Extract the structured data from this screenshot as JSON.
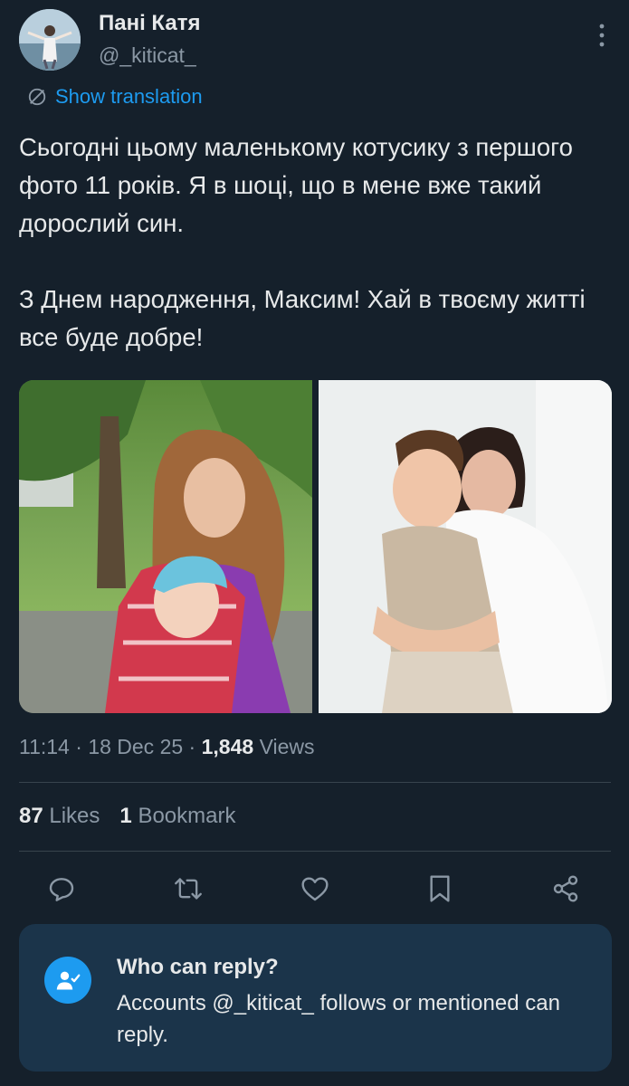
{
  "author": {
    "display_name": "Пані Катя",
    "handle": "@_kiticat_",
    "avatar_icon": "profile-photo"
  },
  "translate_link": "Show translation",
  "tweet": {
    "paragraphs": [
      "Сьогодні цьому маленькому котусику з першого фото 11 років. Я в шоці, що в мене вже такий дорослий син.",
      "З Днем народження, Максим! Хай в твоєму житті все буде добре!"
    ]
  },
  "media": {
    "photo_1": "photo-young-mother-with-baby-in-carrier",
    "photo_2": "photo-mother-hugging-son"
  },
  "meta": {
    "time": "11:14",
    "date": "18 Dec 25",
    "sep": " · ",
    "views_count": "1,848",
    "views_label": "Views"
  },
  "stats": {
    "likes_count": "87",
    "likes_label": "Likes",
    "bookmarks_count": "1",
    "bookmarks_label": "Bookmark"
  },
  "actions": [
    "reply-icon",
    "retweet-icon",
    "like-icon",
    "bookmark-icon",
    "share-icon"
  ],
  "who_can_reply": {
    "title": "Who can reply?",
    "description": "Accounts @_kiticat_ follows or mentioned can reply."
  },
  "colors": {
    "background": "#15202b",
    "accent": "#1d9bf0",
    "muted_text": "#8b98a5",
    "primary_text": "#e7e9ea",
    "card_background": "#1b344a"
  }
}
